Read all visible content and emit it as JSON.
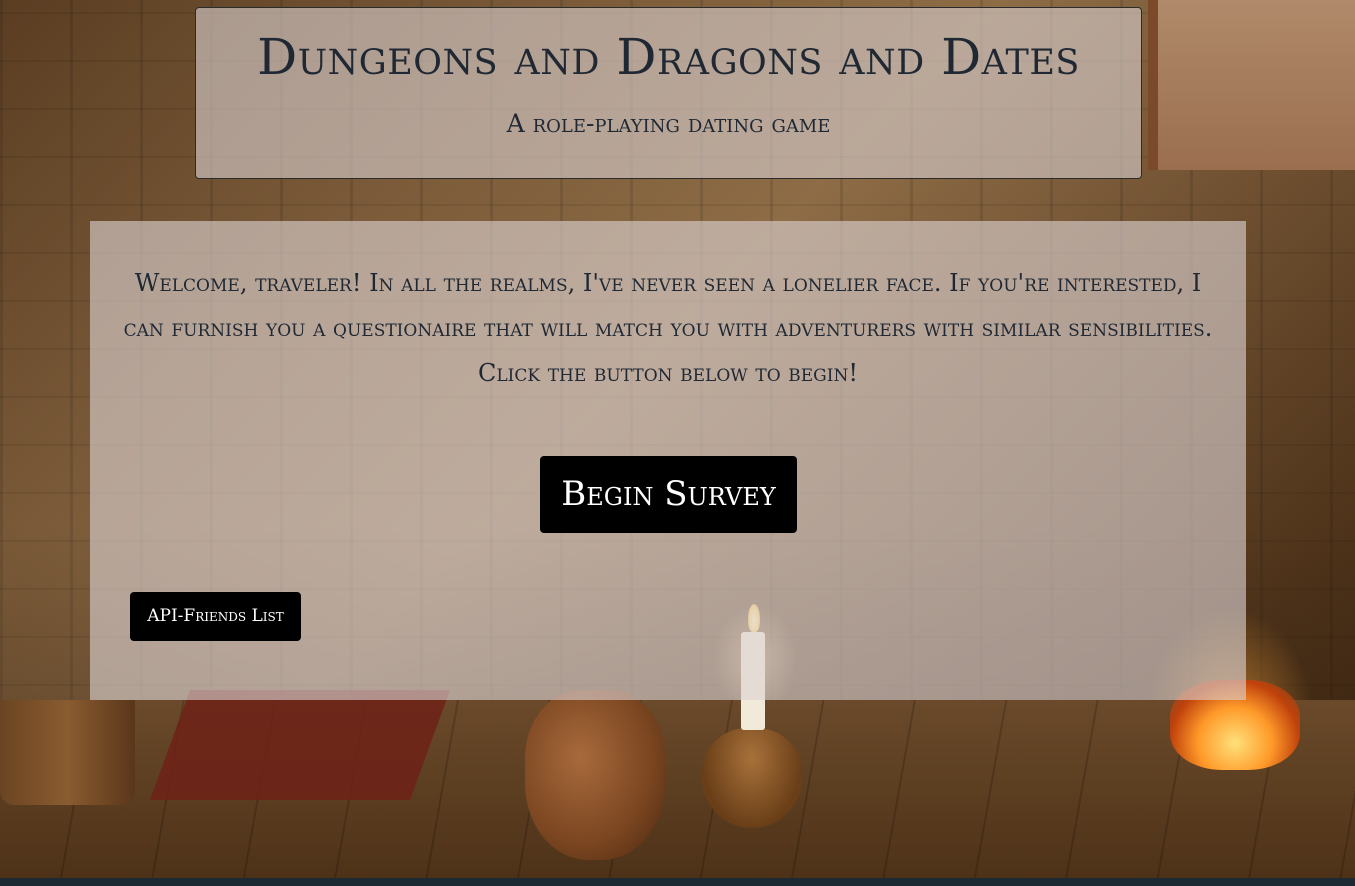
{
  "header": {
    "title": "Dungeons and Dragons and Dates",
    "subtitle": "A role-playing dating game"
  },
  "main": {
    "welcome_text": "Welcome, traveler! In all the realms, I've never seen a lonelier face. If you're interested, I can furnish you a questionaire that will match you with adventurers with similar sensibilities. Click the button below to begin!",
    "begin_button_label": "Begin Survey",
    "friends_button_label": "API-Friends List"
  },
  "colors": {
    "text": "#1f2833",
    "button_bg": "#000000",
    "button_text": "#ffffff",
    "panel_bg": "rgba(220,210,210,0.62)"
  }
}
